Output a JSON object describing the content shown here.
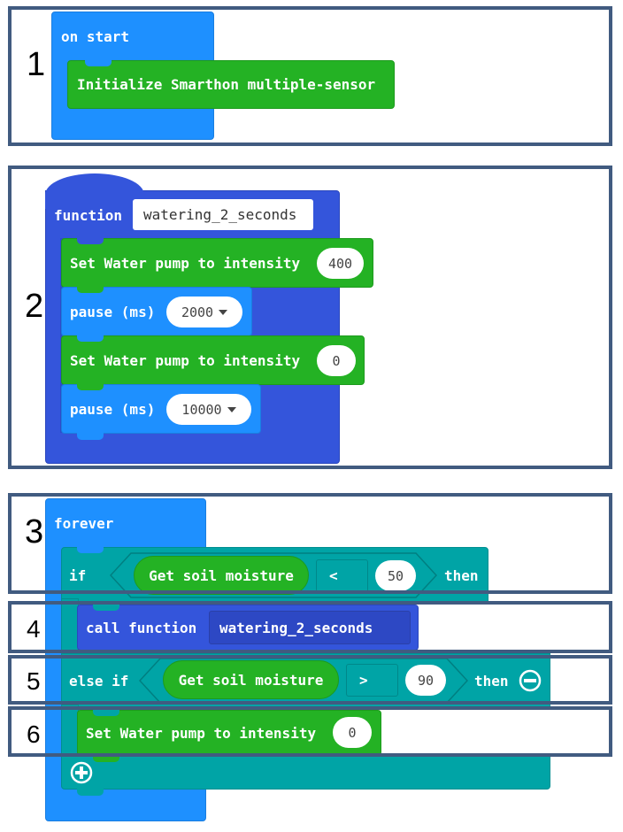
{
  "step_numbers": [
    "1",
    "2",
    "3",
    "4",
    "5",
    "6"
  ],
  "section1": {
    "hat_label": "on start",
    "init_label": "Initialize Smarthon multiple-sensor"
  },
  "section2": {
    "function_keyword": "function",
    "function_name": "watering_2_seconds",
    "set_pump_1": {
      "label": "Set Water pump to intensity",
      "value": "400"
    },
    "pause_1": {
      "label": "pause (ms)",
      "value": "2000"
    },
    "set_pump_2": {
      "label": "Set Water pump to intensity",
      "value": "0"
    },
    "pause_2": {
      "label": "pause (ms)",
      "value": "10000"
    }
  },
  "section3": {
    "forever_label": "forever",
    "if_keyword": "if",
    "then_keyword": "then",
    "condition1": {
      "sensor": "Get soil moisture",
      "operator": "<",
      "value": "50"
    },
    "call_keyword": "call function",
    "call_target": "watering_2_seconds",
    "else_if_keyword": "else if",
    "condition2": {
      "sensor": "Get soil moisture",
      "operator": ">",
      "value": "90"
    },
    "set_pump_3": {
      "label": "Set Water pump to intensity",
      "value": "0"
    }
  },
  "colors": {
    "event_blue": "#1e90ff",
    "sensor_green": "#24b224",
    "function_blue": "#3455db",
    "logic_teal": "#00a4a6",
    "frame_border": "#415b80"
  }
}
